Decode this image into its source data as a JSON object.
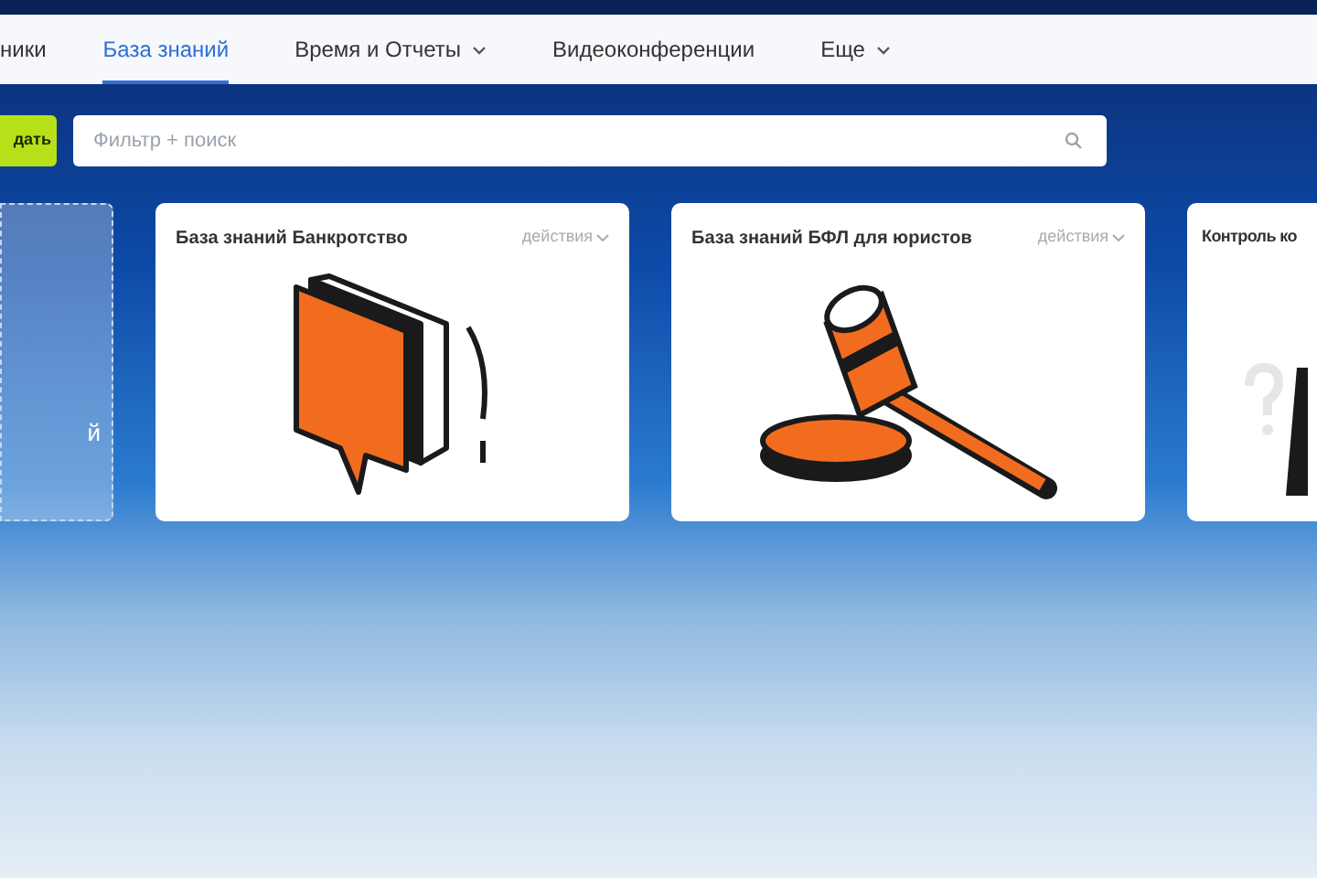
{
  "nav": {
    "tabs": [
      {
        "label": "ники",
        "selected": false,
        "dropdown": false
      },
      {
        "label": "База знаний",
        "selected": true,
        "dropdown": false
      },
      {
        "label": "Время и Отчеты",
        "selected": false,
        "dropdown": true
      },
      {
        "label": "Видеоконференции",
        "selected": false,
        "dropdown": false
      },
      {
        "label": "Еще",
        "selected": false,
        "dropdown": true
      }
    ]
  },
  "toolbar": {
    "create_button": "дать",
    "search": {
      "placeholder": "Фильтр + поиск"
    }
  },
  "add_card": {
    "label": "й"
  },
  "cards": [
    {
      "title": "База знаний Банкротство",
      "actions": "действия",
      "kind": "question"
    },
    {
      "title": "База знаний БФЛ для юристов",
      "actions": "действия",
      "kind": "gavel"
    },
    {
      "title": "Контроль ко",
      "kind": "partial"
    }
  ]
}
